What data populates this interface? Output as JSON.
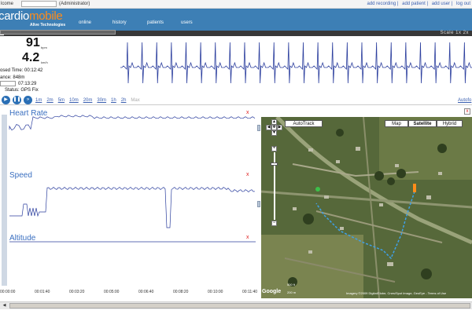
{
  "topbar": {
    "welcome": "lcome",
    "role": "(Administrator)",
    "links": [
      "add recording",
      "add patient",
      "add user",
      "log out"
    ]
  },
  "header": {
    "logo_part1": "cardio",
    "logo_part2": "mobile",
    "tagline": "Alive Technologies",
    "nav": [
      "online",
      "history",
      "patients",
      "users"
    ]
  },
  "strip": {
    "scale": "Scale 1x 2x"
  },
  "stats": {
    "bpm_value": "91",
    "bpm_unit": "bpm",
    "speed_value": "4.2",
    "speed_unit": "km/h",
    "elapsed_label": "osed Time:",
    "elapsed_value": "00:12:42",
    "distance_label": "ance:",
    "distance_value": "848m",
    "clock_value": "07:13:29",
    "gps_label": "Status:",
    "gps_value": "GPS Fix",
    "progress_fraction": 1.0
  },
  "controls": {
    "zooms": [
      "1m",
      "2m",
      "5m",
      "10m",
      "20m",
      "30m",
      "1h",
      "2h"
    ],
    "zoom_disabled": "Max",
    "autofollow": "Autofo"
  },
  "charts": {
    "heart_rate_label": "Heart Rate",
    "speed_label": "Speed",
    "altitude_label": "Altitude",
    "close_symbol": "x",
    "timeline": [
      "00:00:00",
      "00:01:40",
      "00:03:20",
      "00:05:00",
      "00:06:40",
      "00:08:20",
      "00:10:00",
      "00:11:40"
    ]
  },
  "map": {
    "autotrack": "AutoTrack",
    "types": [
      "Map",
      "Satellite",
      "Hybrid"
    ],
    "selected_type": "Satellite",
    "close_symbol": "x",
    "scale_ft": "500 ft",
    "scale_m": "200 m",
    "google": "Google",
    "copyright": "Imagery ©2009 DigitalGlobe, Cnes/Spot Image, GeoEye - Terms of Use",
    "zoom_in": "+",
    "zoom_out": "−"
  },
  "colors": {
    "header_blue": "#3d7fb5",
    "logo_orange": "#ff8c1a",
    "trace_blue": "#2c3f9e",
    "label_blue": "#3a6fc0",
    "close_red": "#e02020",
    "track_blue": "#3fa0e8"
  }
}
